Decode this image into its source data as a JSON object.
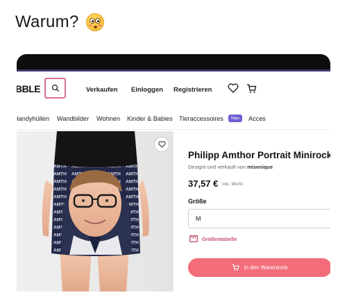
{
  "post": {
    "title": "Warum?",
    "emoji": "flushed-face-emoji"
  },
  "site": {
    "logo": "BBLE",
    "nav": {
      "sell": "Verkaufen",
      "login": "Einloggen",
      "register": "Registrieren"
    },
    "categories": [
      "Handyhüllen",
      "Wandbilder",
      "Wohnen",
      "Kinder & Babies",
      "Tieraccessoires",
      "Acces"
    ],
    "new_badge": "Neu"
  },
  "product": {
    "title": "Philipp Amthor Portrait Minirock",
    "byline_prefix": "Designt und verkauft von ",
    "seller": "misenique",
    "price": "37,57 €",
    "vat": "inkl. MwSt.",
    "size_label": "Größe",
    "size_value": "M",
    "size_chart": "Größentabelle",
    "add_to_cart": "In den Warenkorb",
    "pattern_text": "AMTHOR"
  },
  "colors": {
    "accent": "#f26c7a",
    "badge": "#6b5fd0",
    "search_border": "#d4708a",
    "link": "#c2506a"
  }
}
